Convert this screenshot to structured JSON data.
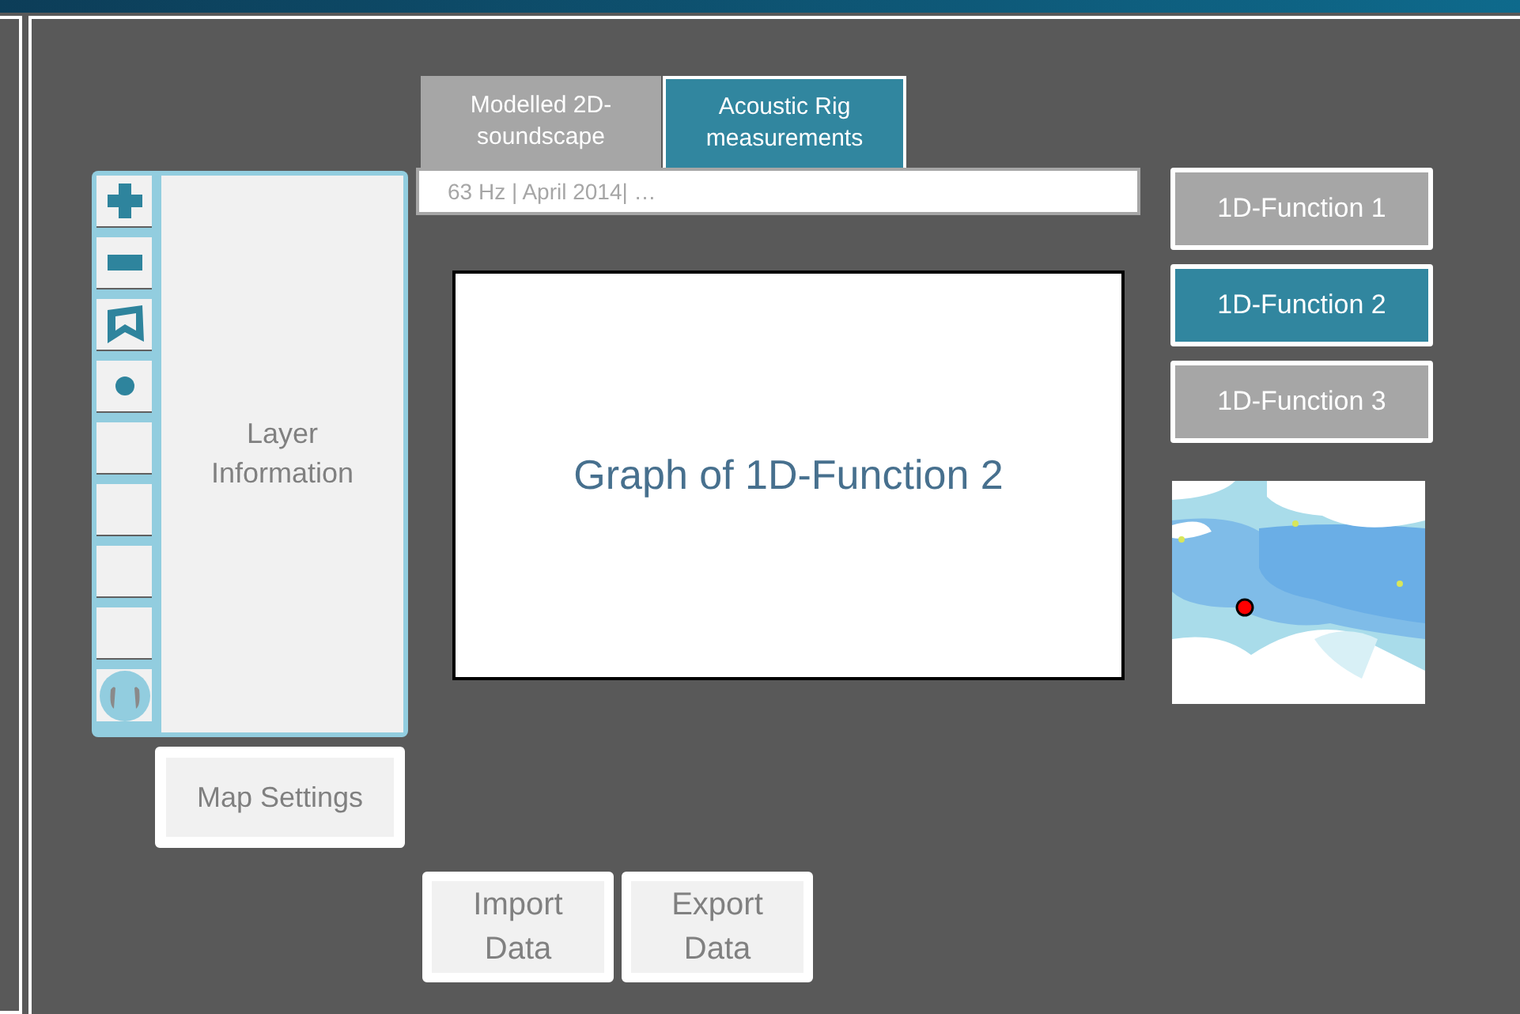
{
  "tools": [
    {
      "kind": "plus"
    },
    {
      "kind": "minus"
    },
    {
      "kind": "shape"
    },
    {
      "kind": "dot"
    },
    {
      "kind": "blank"
    },
    {
      "kind": "blank"
    },
    {
      "kind": "blank"
    },
    {
      "kind": "blank"
    },
    {
      "kind": "headphones"
    }
  ],
  "layer_panel": {
    "label": "Layer Information"
  },
  "map_settings_button": "Map Settings",
  "tabs": [
    {
      "label": "Modelled 2D-soundscape",
      "selected": false
    },
    {
      "label": "Acoustic Rig measurements",
      "selected": true
    }
  ],
  "search": {
    "value": "63 Hz | April 2014| …"
  },
  "graph": {
    "label": "Graph of 1D-Function 2"
  },
  "data_buttons": [
    "Import Data",
    "Export Data"
  ],
  "functions": [
    {
      "label": "1D-Function 1",
      "selected": false
    },
    {
      "label": "1D-Function 2",
      "selected": true
    },
    {
      "label": "1D-Function 3",
      "selected": false
    }
  ],
  "map": {
    "kind": "picture"
  }
}
